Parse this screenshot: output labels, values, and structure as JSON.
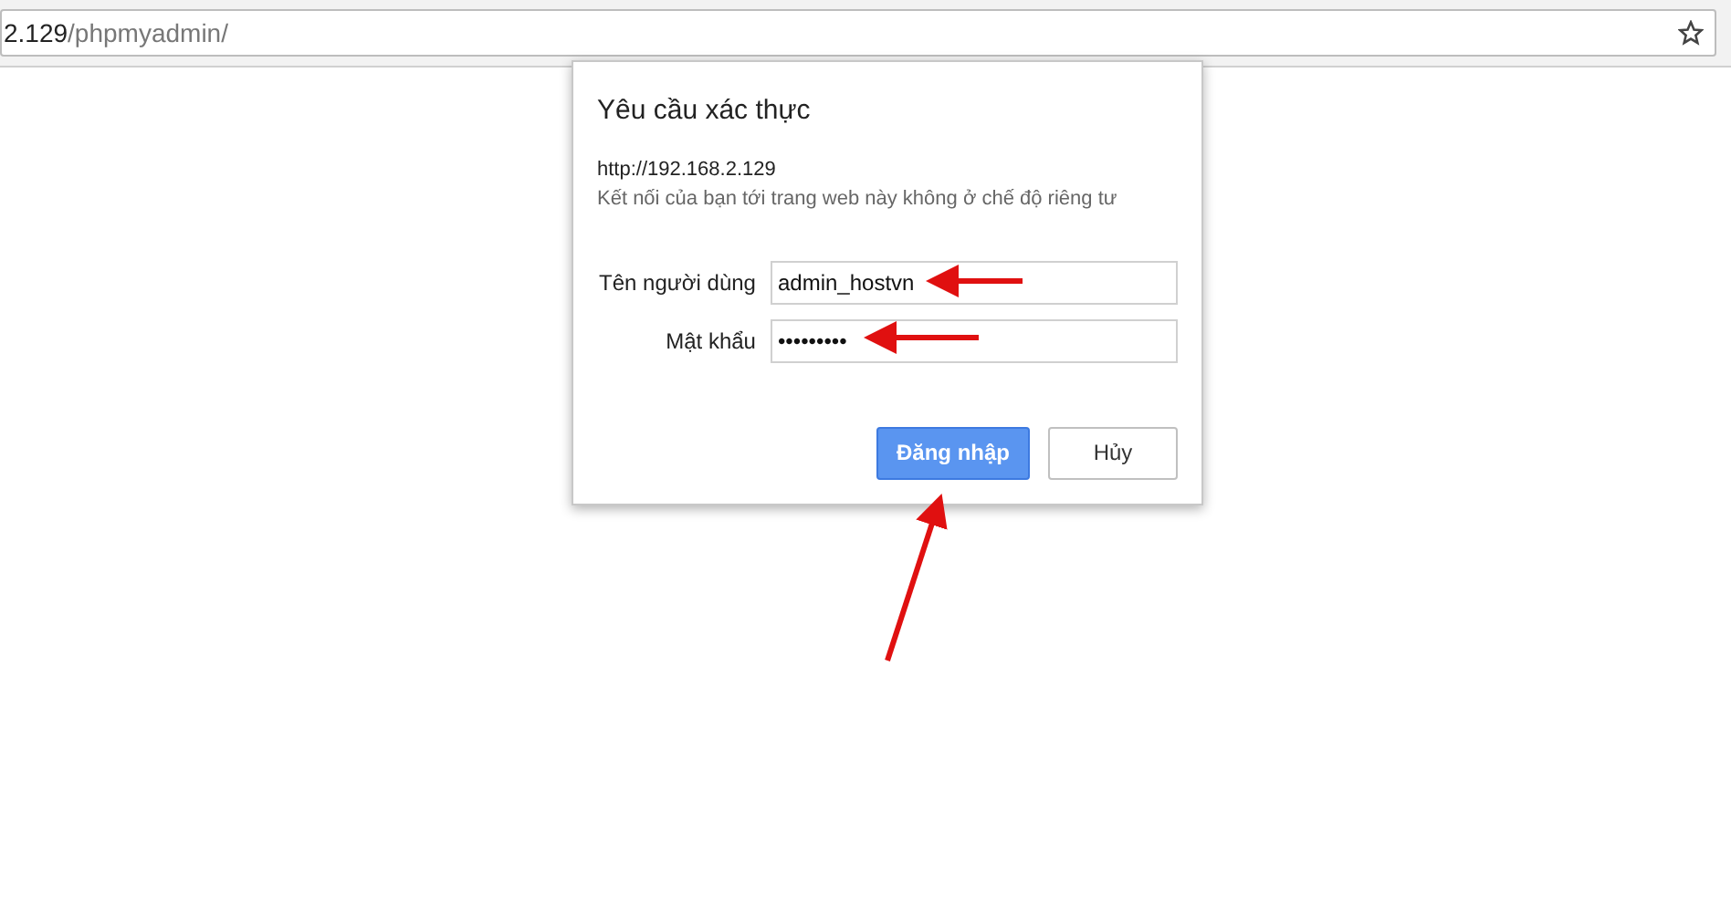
{
  "address_bar": {
    "host": "2.129",
    "path": "/phpmyadmin/"
  },
  "dialog": {
    "title": "Yêu cầu xác thực",
    "url": "http://192.168.2.129",
    "notice": "Kết nối của bạn tới trang web này không ở chế độ riêng tư",
    "fields": [
      {
        "label": "Tên người dùng",
        "value": "admin_hostvn"
      },
      {
        "label": "Mật khẩu",
        "value": "•••••••••"
      }
    ],
    "buttons": [
      {
        "label": "Đăng nhập",
        "primary": true
      },
      {
        "label": "Hủy",
        "primary": false
      }
    ]
  }
}
